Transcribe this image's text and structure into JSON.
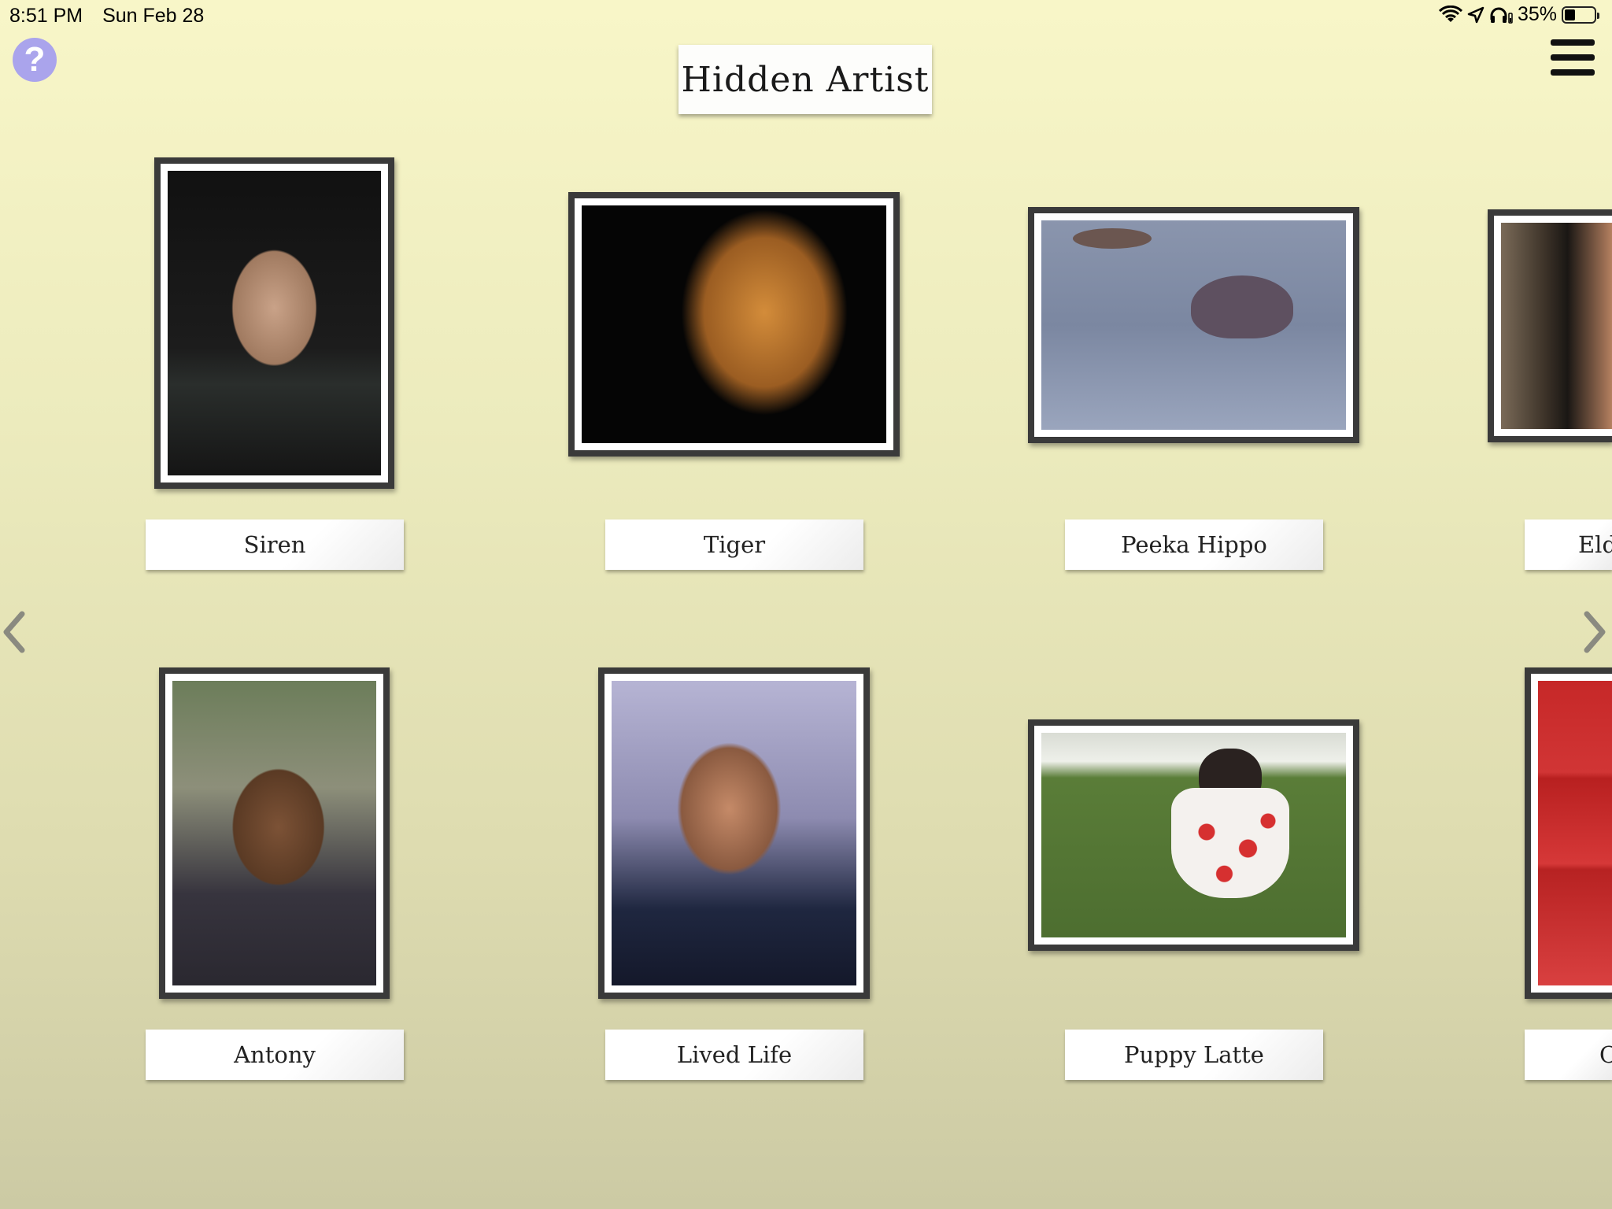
{
  "status_bar": {
    "time": "8:51 PM",
    "date": "Sun Feb 28",
    "battery": "35%",
    "battery_level": 0.35
  },
  "header": {
    "title": "Hidden Artist",
    "help_glyph": "?"
  },
  "gallery": {
    "row1": [
      {
        "label": "Siren",
        "icon": "portrait-woman-in-water"
      },
      {
        "label": "Tiger",
        "icon": "tiger-painting"
      },
      {
        "label": "Peeka Hippo",
        "icon": "hippo-in-water"
      },
      {
        "label": "Elde",
        "icon": "partial-portrait"
      }
    ],
    "row2": [
      {
        "label": "Antony",
        "icon": "portrait-man-moustache"
      },
      {
        "label": "Lived Life",
        "icon": "portrait-old-man-beard"
      },
      {
        "label": "Puppy Latte",
        "icon": "puppy-in-cup"
      },
      {
        "label": "C",
        "icon": "partial-red-painting"
      }
    ]
  },
  "colors": {
    "help_button": "#aaa4ec",
    "frame": "#3a3a3a",
    "background_top": "#f8f6c8",
    "background_bottom": "#cccaa4"
  }
}
